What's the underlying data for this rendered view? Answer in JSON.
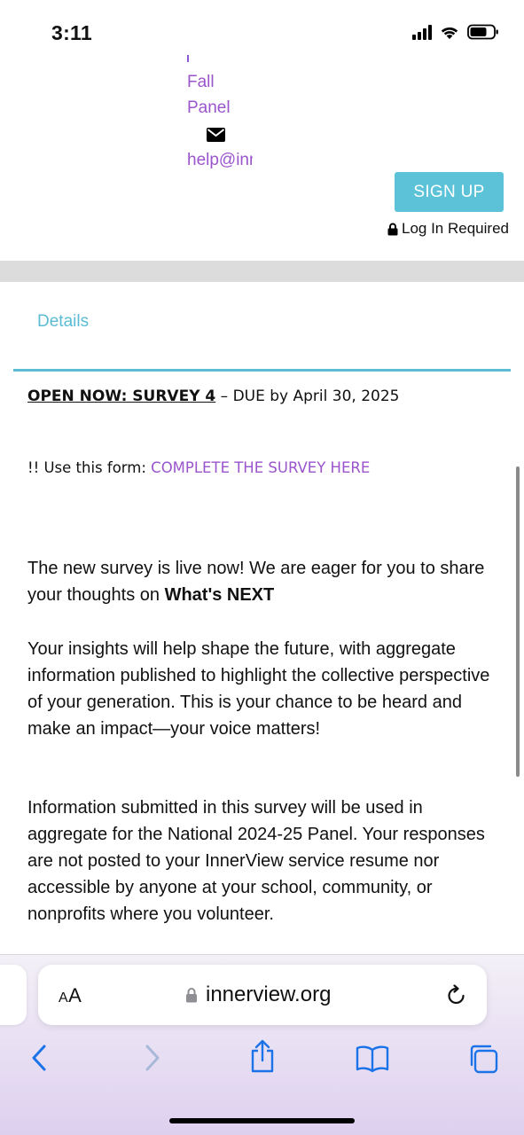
{
  "status_bar": {
    "time": "3:11"
  },
  "header": {
    "link_fall": "Fall",
    "link_panel": "Panel",
    "email": "help@innerview.org",
    "signup_label": "SIGN UP",
    "login_required": "Log In Required"
  },
  "tabs": {
    "details": "Details"
  },
  "content": {
    "open_title": "OPEN NOW: SURVEY 4",
    "open_due": " – DUE by April 30, 2025",
    "form_prefix": "!! Use this form: ",
    "form_link": "COMPLETE THE SURVEY HERE",
    "p1_text": "The new survey is live now! We are eager for you to share your thoughts on ",
    "p1_bold": "What's NEXT",
    "p2": "Your insights will help shape the future, with aggregate information published to highlight the collective perspective of your generation. This is your chance to be heard and make an impact—your voice matters!",
    "p3": "Information submitted in this survey will be used in aggregate for the National 2024-25 Panel.  Your responses are not posted to your InnerView service resume nor accessible by anyone at your school, community, or nonprofits where you volunteer."
  },
  "browser": {
    "text_size_label": "AA",
    "url": "innerview.org"
  },
  "icons": {
    "signal": "signal-icon",
    "wifi": "wifi-icon",
    "battery": "battery-icon",
    "mail": "envelope-icon",
    "lock": "lock-icon",
    "reload": "reload-icon",
    "back": "chevron-left-icon",
    "forward": "chevron-right-icon",
    "share": "share-icon",
    "bookmarks": "book-icon",
    "tabs": "tabs-icon"
  },
  "colors": {
    "accent_teal": "#5bc2d8",
    "link_purple": "#9a55cc",
    "ios_blue": "#1a73e8"
  }
}
